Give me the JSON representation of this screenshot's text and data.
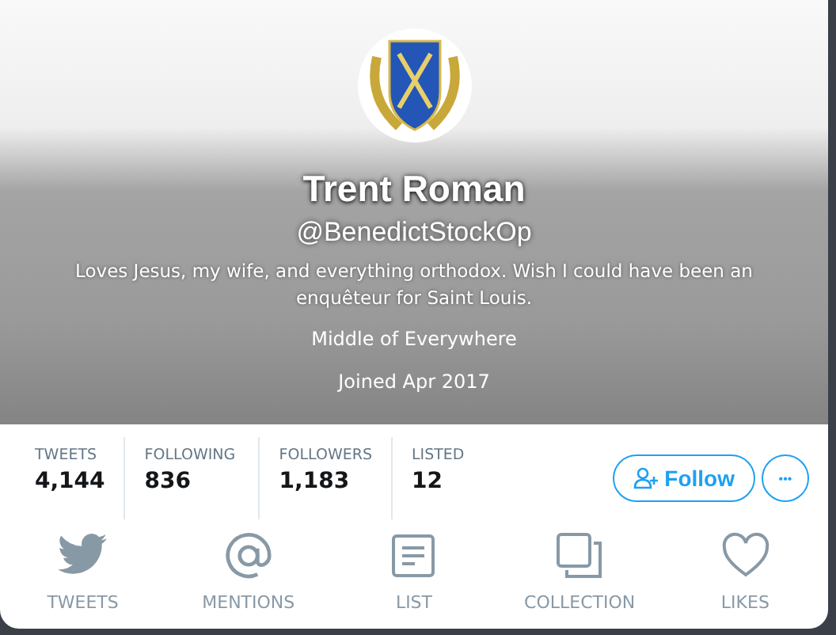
{
  "profile": {
    "name": "Trent Roman",
    "handle": "@BenedictStockOp",
    "bio": "Loves Jesus, my wife, and everything orthodox. Wish I could have been an enquêteur for Saint Louis.",
    "location": "Middle of Everywhere",
    "joined": "Joined Apr 2017"
  },
  "stats": [
    {
      "label": "TWEETS",
      "value": "4,144"
    },
    {
      "label": "FOLLOWING",
      "value": "836"
    },
    {
      "label": "FOLLOWERS",
      "value": "1,183"
    },
    {
      "label": "LISTED",
      "value": "12"
    }
  ],
  "follow_button": "Follow",
  "more_button": "•••",
  "tabs": [
    {
      "kind": "bird",
      "label": "TWEETS"
    },
    {
      "kind": "at",
      "label": "MENTIONS"
    },
    {
      "kind": "list",
      "label": "LIST"
    },
    {
      "kind": "collection",
      "label": "COLLECTION"
    },
    {
      "kind": "heart",
      "label": "LIKES"
    }
  ]
}
